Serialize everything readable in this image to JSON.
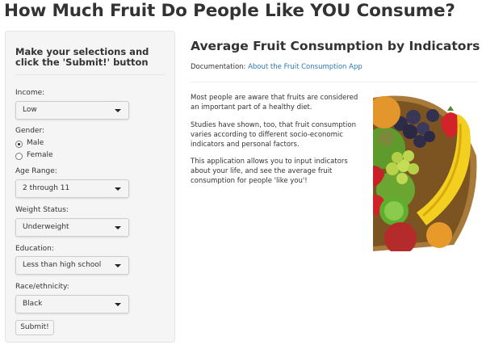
{
  "page": {
    "title": "How Much Fruit Do People Like YOU Consume?"
  },
  "sidebar": {
    "heading": "Make your selections and click the 'Submit!' button",
    "income": {
      "label": "Income:",
      "value": "Low"
    },
    "gender": {
      "label": "Gender:",
      "options": [
        {
          "label": "Male",
          "checked": true
        },
        {
          "label": "Female",
          "checked": false
        }
      ]
    },
    "age_range": {
      "label": "Age Range:",
      "value": "2 through 11"
    },
    "weight_status": {
      "label": "Weight Status:",
      "value": "Underweight"
    },
    "education": {
      "label": "Education:",
      "value": "Less than high school"
    },
    "race": {
      "label": "Race/ethnicity:",
      "value": "Black"
    },
    "submit_label": "Submit!"
  },
  "main": {
    "heading": "Average Fruit Consumption by Indicators",
    "doc_prefix": "Documentation:",
    "doc_link": "About the Fruit Consumption App",
    "paragraphs": [
      "Most people are aware that fruits are considered an important part of a healthy diet.",
      "Studies have shown, too, that fruit consumption varies according to different socio-economic indicators and personal factors.",
      "This application allows you to input indicators about your life, and see the average fruit consumption for people 'like you'!"
    ]
  },
  "colors": {
    "link": "#2a7ab0",
    "sidebar_bg": "#f5f5f5",
    "text": "#333333"
  },
  "icons": {
    "select_caret": "caret-down-icon",
    "radio": "radio-icon",
    "image": "fruit-basket-image"
  }
}
